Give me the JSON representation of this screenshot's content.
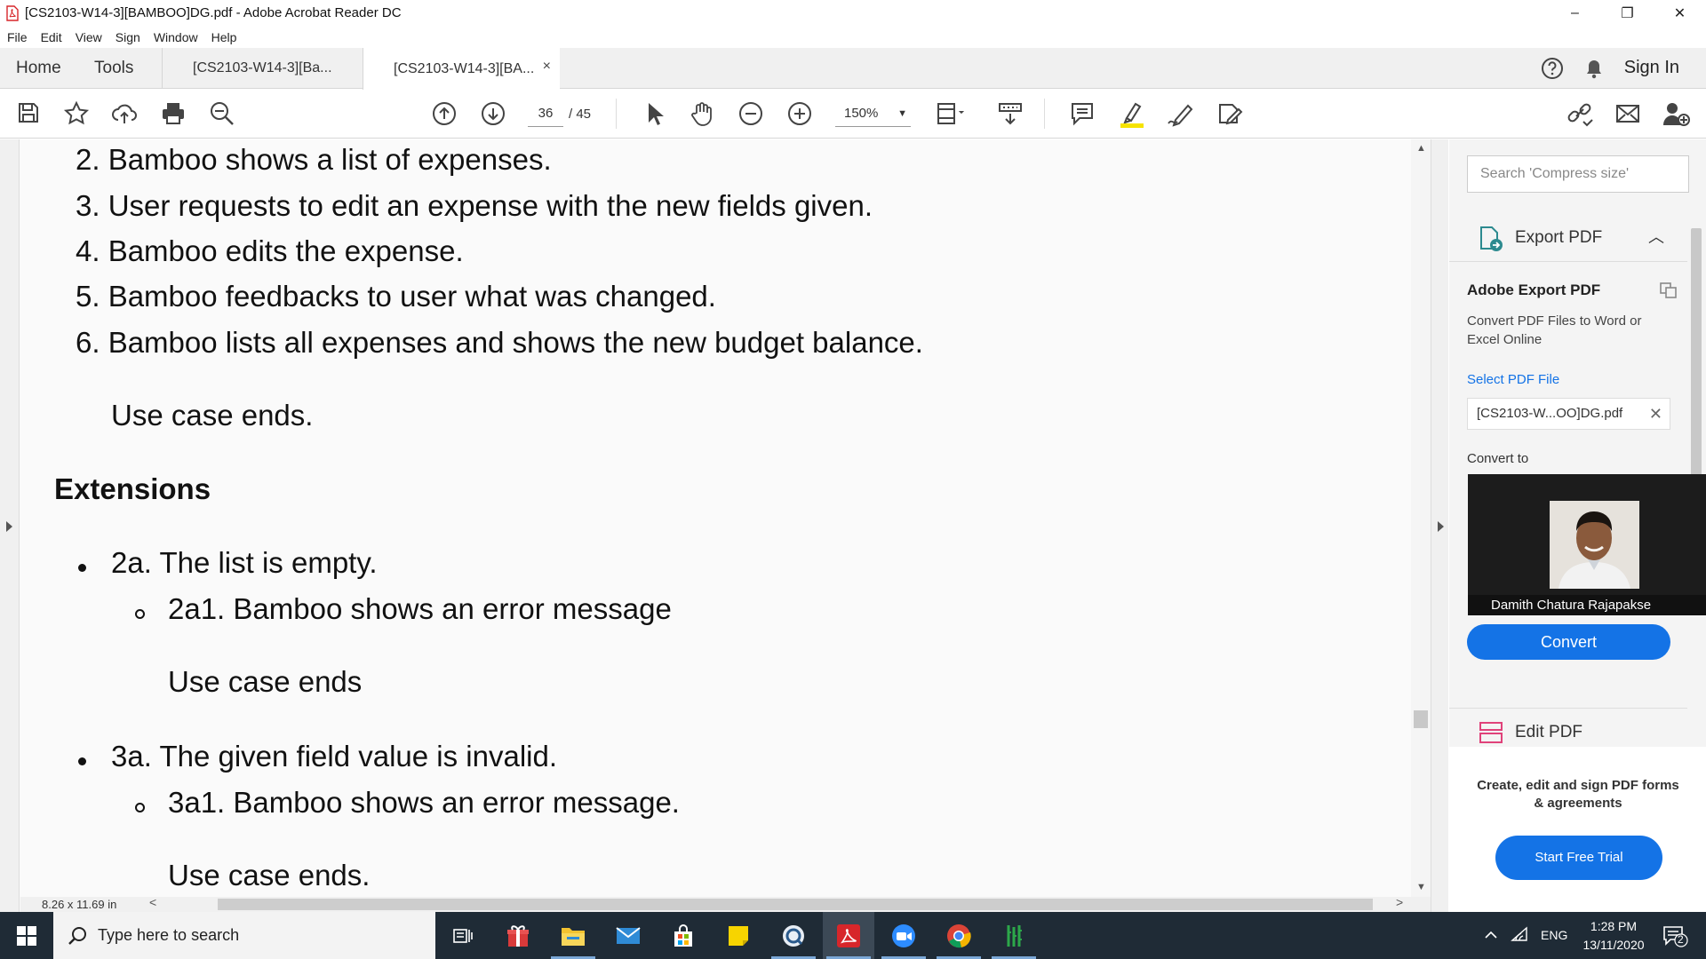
{
  "window": {
    "title": "[CS2103-W14-3][BAMBOO]DG.pdf - Adobe Acrobat Reader DC",
    "minimize": "–",
    "maximize": "❐",
    "close": "✕"
  },
  "menu": [
    "File",
    "Edit",
    "View",
    "Sign",
    "Window",
    "Help"
  ],
  "tabs": {
    "home": "Home",
    "tools": "Tools",
    "doc_tab_1": "[CS2103-W14-3][Ba...",
    "doc_tab_2": "[CS2103-W14-3][BA...",
    "close_glyph": "×",
    "sign_in": "Sign In"
  },
  "toolbar": {
    "current_page": "36",
    "total_pages": "/ 45",
    "zoom": "150%",
    "icons": [
      "save-icon",
      "star-icon",
      "upload-icon",
      "print-icon",
      "search-zoom-icon",
      "page-up-icon",
      "page-down-icon",
      "select-arrow-icon",
      "hand-icon",
      "zoom-out-icon",
      "zoom-in-icon",
      "fit-page-icon",
      "scroll-mode-icon",
      "comment-icon",
      "highlight-icon",
      "sign-pen-icon",
      "edit-text-icon",
      "share-link-icon",
      "email-icon",
      "add-user-icon"
    ]
  },
  "document": {
    "steps": [
      "2. Bamboo shows a list of expenses.",
      "3. User requests to edit an expense with the new fields given.",
      "4. Bamboo edits the expense.",
      "5. Bamboo feedbacks to user what was changed.",
      "6. Bamboo lists all expenses and shows the new budget balance."
    ],
    "use_case_ends_main": "Use case ends.",
    "extensions_heading": "Extensions",
    "ext_2a": "2a. The list is empty.",
    "ext_2a1": "2a1. Bamboo shows an error message",
    "ext_2a_end": "Use case ends",
    "ext_3a": "3a. The given field value is invalid.",
    "ext_3a1": "3a1. Bamboo shows an error message.",
    "ext_3a_end": "Use case ends."
  },
  "status": {
    "page_size": "8.26 x 11.69 in"
  },
  "panel": {
    "search_placeholder": "Search 'Compress size'",
    "section_label": "Export PDF",
    "export_title": "Adobe Export PDF",
    "export_desc": "Convert PDF Files to Word or Excel Online",
    "select_file": "Select PDF File",
    "file_name": "[CS2103-W...OO]DG.pdf",
    "convert_to": "Convert to",
    "convert_button": "Convert",
    "edit_label": "Edit PDF",
    "promo": "Create, edit and sign PDF forms & agreements",
    "trial_button": "Start Free Trial"
  },
  "video": {
    "participant": "Damith Chatura Rajapakse"
  },
  "taskbar": {
    "search_placeholder": "Type here to search",
    "language": "ENG",
    "time": "1:28 PM",
    "date": "13/11/2020",
    "notification_count": "2",
    "apps": [
      "task-view-icon",
      "gift-app-icon",
      "file-explorer-icon",
      "mail-icon",
      "store-icon",
      "sticky-notes-icon",
      "browser-q-icon",
      "acrobat-icon",
      "zoom-icon",
      "chrome-icon",
      "bamboo-app-icon"
    ]
  },
  "colors": {
    "accent": "#1473e6",
    "taskbar": "#1f2b36",
    "acrobat_red": "#d7262a"
  }
}
